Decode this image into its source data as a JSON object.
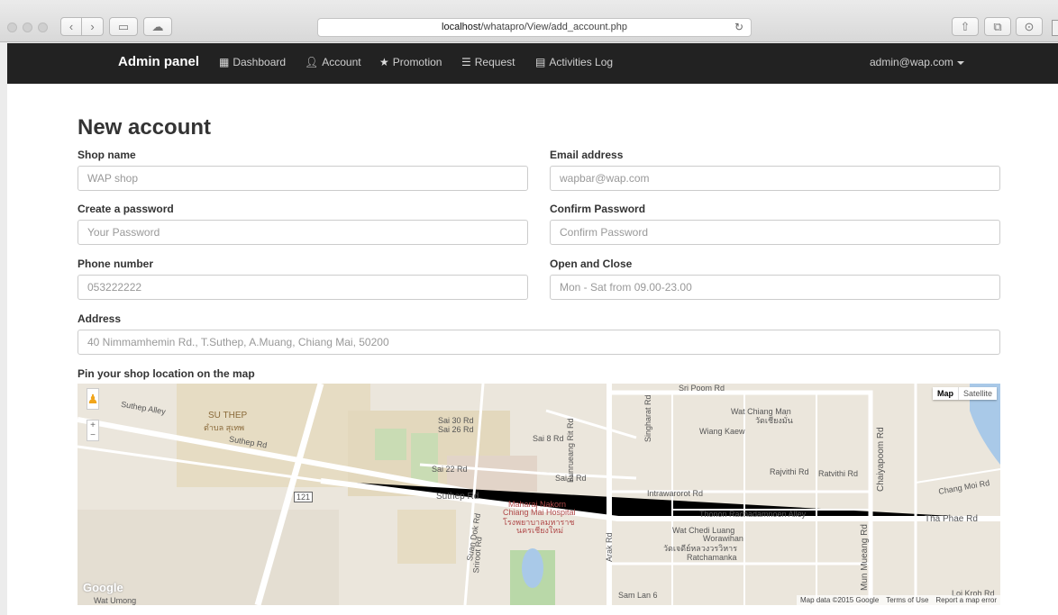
{
  "browser": {
    "url_host": "localhost",
    "url_path": "/whatapro/View/add_account.php"
  },
  "navbar": {
    "brand": "Admin panel",
    "items": [
      {
        "label": "Dashboard",
        "icon": "grid-icon"
      },
      {
        "label": "Account",
        "icon": "user-icon"
      },
      {
        "label": "Promotion",
        "icon": "star-icon"
      },
      {
        "label": "Request",
        "icon": "list-icon"
      },
      {
        "label": "Activities Log",
        "icon": "calendar-icon"
      }
    ],
    "user": "admin@wap.com"
  },
  "form": {
    "title": "New account",
    "shop_name": {
      "label": "Shop name",
      "placeholder": "WAP shop"
    },
    "email": {
      "label": "Email address",
      "placeholder": "wapbar@wap.com"
    },
    "password": {
      "label": "Create a password",
      "placeholder": "Your Password"
    },
    "confirm": {
      "label": "Confirm Password",
      "placeholder": "Confirm Password"
    },
    "phone": {
      "label": "Phone number",
      "placeholder": "053222222"
    },
    "hours": {
      "label": "Open and Close",
      "placeholder": "Mon - Sat from 09.00-23.00"
    },
    "address": {
      "label": "Address",
      "placeholder": "40 Nimmamhemin Rd., T.Suthep, A.Muang, Chiang Mai, 50200"
    },
    "map_label": "Pin your shop location on the map"
  },
  "map": {
    "type_map": "Map",
    "type_satellite": "Satellite",
    "zoom_in": "+",
    "zoom_out": "−",
    "logo": "Google",
    "attribution": "Map data ©2015 Google",
    "terms": "Terms of Use",
    "report": "Report a map error",
    "labels": {
      "suthep_alley": "Suthep Alley",
      "su_thep": "SU THEP",
      "su_thep_th": "ตำบล สุเทพ",
      "suthep_rd_a": "Suthep Rd",
      "suthep_rd_b": "Suthep Rd",
      "sai30": "Sai 30 Rd",
      "sai26": "Sai 26 Rd",
      "sai8": "Sai 8 Rd",
      "sai22": "Sai 22 Rd",
      "sai2": "Sai 2 Rd",
      "maharaj1": "Maharaj Nakorn",
      "maharaj2": "Chiang Mai Hospital",
      "maharaj3": "โรงพยาบาลมหาราช",
      "maharaj4": "นครเชียงใหม่",
      "bunrueang": "Bunrueang Rit Rd",
      "arak": "Arak Rd",
      "suan_dok": "Suan Dok Rd",
      "sriroot": "Sriroot Rd",
      "sri_poom": "Sri Poom Rd",
      "wat_chiang_man": "Wat Chiang Man",
      "wat_chiang_man_th": "วัดเชียงมั่น",
      "wiang_kaew": "Wiang Kaew",
      "singharat": "Singharat Rd",
      "rajvithi": "Rajvithi Rd",
      "ratvithi": "Ratvithi Rd",
      "intrawarorot": "Intrawarorot Rd",
      "thonon": "Thonon Rachadamnoen Alley",
      "wat_chedi": "Wat Chedi Luang",
      "worawihan": "Worawihan",
      "wat_chedi_th": "วัดเจดีย์หลวงวรวิหาร",
      "ratchamanka": "Ratchamanka",
      "chaiyapoom": "Chaiyapoom Rd",
      "mun_mueang": "Mun Mueang Rd",
      "tha_phae": "Tha Phae Rd",
      "chang_moi": "Chang Moi Rd",
      "loi_kroh": "Loi Kroh Rd",
      "sam_lan": "Sam Lan 6",
      "wat_umong": "Wat Umong",
      "route121": "121"
    }
  }
}
